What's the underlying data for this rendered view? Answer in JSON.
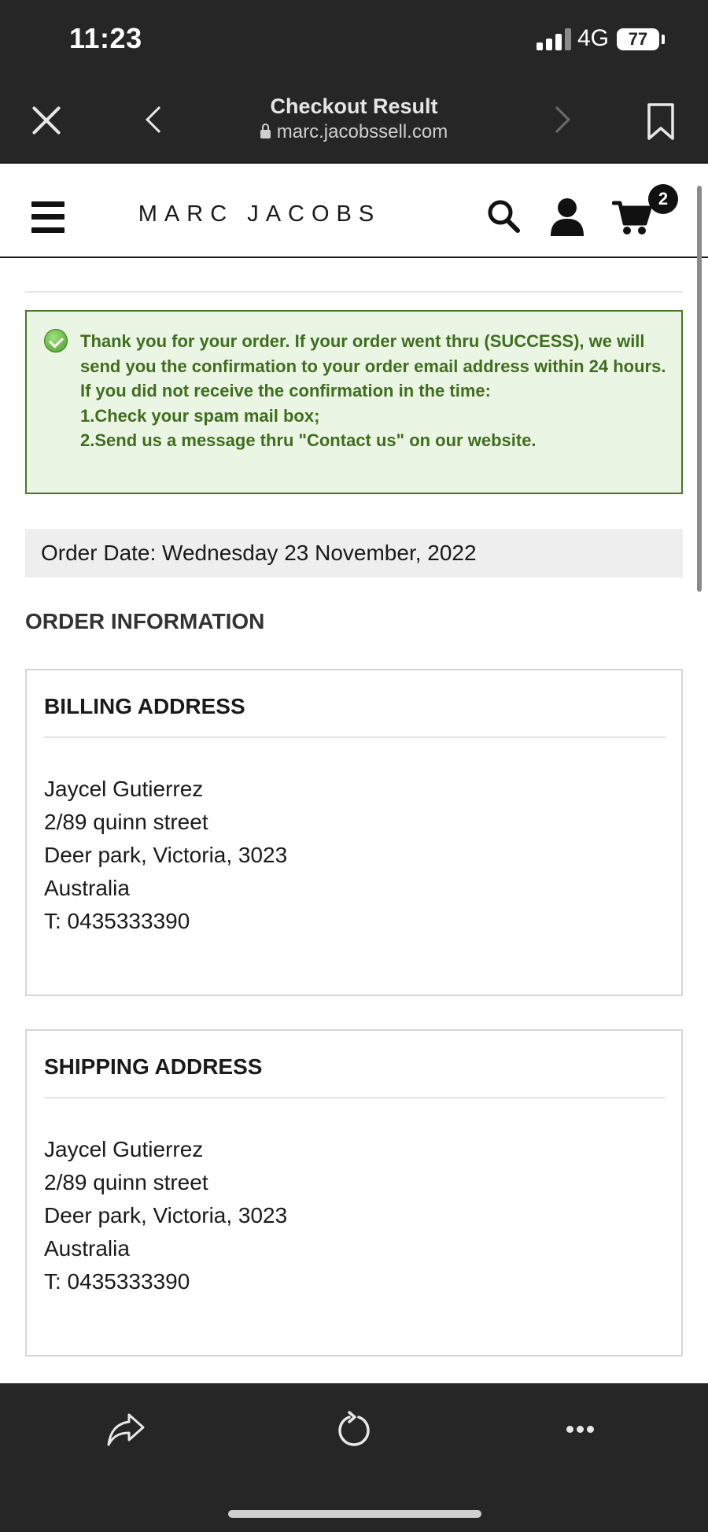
{
  "status_bar": {
    "time": "11:23",
    "network": "4G",
    "battery": "77"
  },
  "browser": {
    "title": "Checkout Result",
    "url": "marc.jacobssell.com"
  },
  "header": {
    "brand": "MARC JACOBS",
    "cart_count": "2"
  },
  "notice": {
    "lines": [
      "Thank you for your order. If your order went thru (SUCCESS), we will send you the confirmation to your order email address within 24 hours.",
      "If you did not receive the confirmation in the time:",
      "1.Check your spam mail box;",
      "2.Send us a message thru \"Contact us\" on our website."
    ]
  },
  "order": {
    "date_text": "Order Date: Wednesday 23 November, 2022",
    "section_heading": "ORDER INFORMATION"
  },
  "billing": {
    "title": "BILLING ADDRESS",
    "lines": [
      "Jaycel Gutierrez",
      "2/89 quinn street",
      "Deer park, Victoria, 3023",
      "Australia",
      "T: 0435333390"
    ]
  },
  "shipping": {
    "title": "SHIPPING ADDRESS",
    "lines": [
      "Jaycel Gutierrez",
      "2/89 quinn street",
      "Deer park, Victoria, 3023",
      "Australia",
      "T: 0435333390"
    ]
  },
  "colors": {
    "success_text": "#3f6e1f",
    "success_bg": "#ebf5e3",
    "success_border": "#49762a",
    "chrome_bg": "#262626"
  }
}
